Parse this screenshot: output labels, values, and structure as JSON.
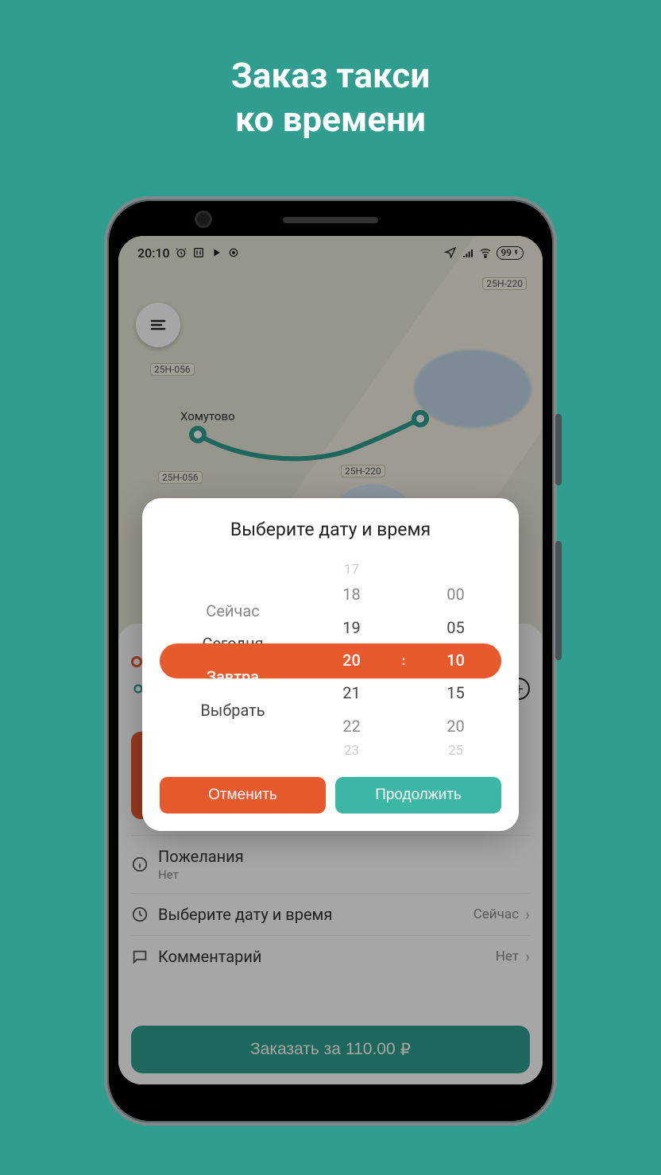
{
  "promo": {
    "line1": "Заказ такси",
    "line2": "ко времени"
  },
  "status_bar": {
    "time": "20:10",
    "battery": "99"
  },
  "map": {
    "place": "Хомутово",
    "roads": [
      "25Н-056",
      "25Н-056",
      "25Н-220",
      "25Н-220"
    ]
  },
  "sheet": {
    "wishes": {
      "label": "Пожелания",
      "value": "Нет"
    },
    "datetime": {
      "label": "Выберите дату и время",
      "value": "Сейчас"
    },
    "comment": {
      "label": "Комментарий",
      "value": "Нет"
    },
    "order_button_prefix": "Заказать за",
    "order_price": "110.00",
    "order_currency": "₽"
  },
  "modal": {
    "title": "Выберите дату и время",
    "day_col": [
      "",
      "Сейчас",
      "Сегодня",
      "Завтра",
      "Выбрать",
      ""
    ],
    "hour_col": [
      "17",
      "18",
      "19",
      "20",
      "21",
      "22",
      "23"
    ],
    "minute_col": [
      "",
      "00",
      "05",
      "10",
      "15",
      "20",
      "25"
    ],
    "selected": {
      "day": "Завтра",
      "hour": "20",
      "minute": "10"
    },
    "cancel": "Отменить",
    "continue": "Продолжить"
  }
}
